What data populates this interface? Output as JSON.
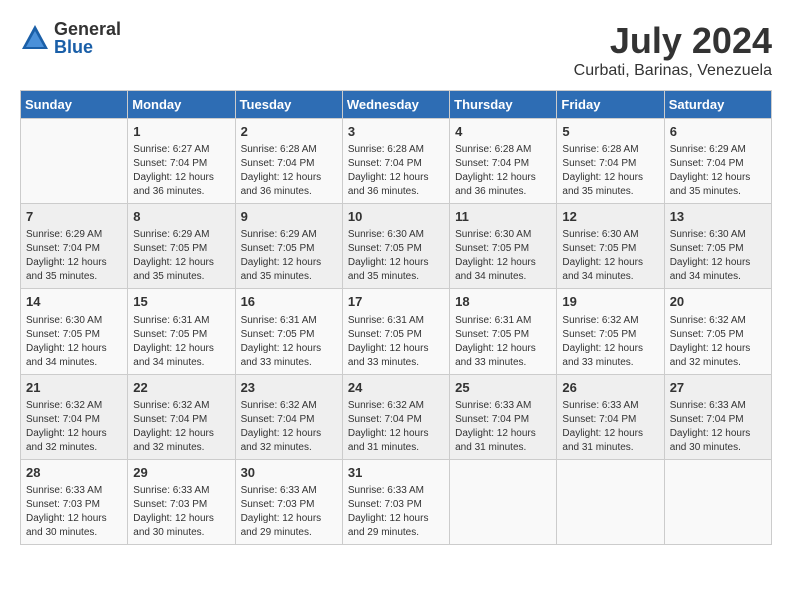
{
  "logo": {
    "general": "General",
    "blue": "Blue"
  },
  "title": {
    "month_year": "July 2024",
    "location": "Curbati, Barinas, Venezuela"
  },
  "days_of_week": [
    "Sunday",
    "Monday",
    "Tuesday",
    "Wednesday",
    "Thursday",
    "Friday",
    "Saturday"
  ],
  "weeks": [
    [
      {
        "day": "",
        "info": ""
      },
      {
        "day": "1",
        "info": "Sunrise: 6:27 AM\nSunset: 7:04 PM\nDaylight: 12 hours\nand 36 minutes."
      },
      {
        "day": "2",
        "info": "Sunrise: 6:28 AM\nSunset: 7:04 PM\nDaylight: 12 hours\nand 36 minutes."
      },
      {
        "day": "3",
        "info": "Sunrise: 6:28 AM\nSunset: 7:04 PM\nDaylight: 12 hours\nand 36 minutes."
      },
      {
        "day": "4",
        "info": "Sunrise: 6:28 AM\nSunset: 7:04 PM\nDaylight: 12 hours\nand 36 minutes."
      },
      {
        "day": "5",
        "info": "Sunrise: 6:28 AM\nSunset: 7:04 PM\nDaylight: 12 hours\nand 35 minutes."
      },
      {
        "day": "6",
        "info": "Sunrise: 6:29 AM\nSunset: 7:04 PM\nDaylight: 12 hours\nand 35 minutes."
      }
    ],
    [
      {
        "day": "7",
        "info": "Sunrise: 6:29 AM\nSunset: 7:04 PM\nDaylight: 12 hours\nand 35 minutes."
      },
      {
        "day": "8",
        "info": "Sunrise: 6:29 AM\nSunset: 7:05 PM\nDaylight: 12 hours\nand 35 minutes."
      },
      {
        "day": "9",
        "info": "Sunrise: 6:29 AM\nSunset: 7:05 PM\nDaylight: 12 hours\nand 35 minutes."
      },
      {
        "day": "10",
        "info": "Sunrise: 6:30 AM\nSunset: 7:05 PM\nDaylight: 12 hours\nand 35 minutes."
      },
      {
        "day": "11",
        "info": "Sunrise: 6:30 AM\nSunset: 7:05 PM\nDaylight: 12 hours\nand 34 minutes."
      },
      {
        "day": "12",
        "info": "Sunrise: 6:30 AM\nSunset: 7:05 PM\nDaylight: 12 hours\nand 34 minutes."
      },
      {
        "day": "13",
        "info": "Sunrise: 6:30 AM\nSunset: 7:05 PM\nDaylight: 12 hours\nand 34 minutes."
      }
    ],
    [
      {
        "day": "14",
        "info": "Sunrise: 6:30 AM\nSunset: 7:05 PM\nDaylight: 12 hours\nand 34 minutes."
      },
      {
        "day": "15",
        "info": "Sunrise: 6:31 AM\nSunset: 7:05 PM\nDaylight: 12 hours\nand 34 minutes."
      },
      {
        "day": "16",
        "info": "Sunrise: 6:31 AM\nSunset: 7:05 PM\nDaylight: 12 hours\nand 33 minutes."
      },
      {
        "day": "17",
        "info": "Sunrise: 6:31 AM\nSunset: 7:05 PM\nDaylight: 12 hours\nand 33 minutes."
      },
      {
        "day": "18",
        "info": "Sunrise: 6:31 AM\nSunset: 7:05 PM\nDaylight: 12 hours\nand 33 minutes."
      },
      {
        "day": "19",
        "info": "Sunrise: 6:32 AM\nSunset: 7:05 PM\nDaylight: 12 hours\nand 33 minutes."
      },
      {
        "day": "20",
        "info": "Sunrise: 6:32 AM\nSunset: 7:05 PM\nDaylight: 12 hours\nand 32 minutes."
      }
    ],
    [
      {
        "day": "21",
        "info": "Sunrise: 6:32 AM\nSunset: 7:04 PM\nDaylight: 12 hours\nand 32 minutes."
      },
      {
        "day": "22",
        "info": "Sunrise: 6:32 AM\nSunset: 7:04 PM\nDaylight: 12 hours\nand 32 minutes."
      },
      {
        "day": "23",
        "info": "Sunrise: 6:32 AM\nSunset: 7:04 PM\nDaylight: 12 hours\nand 32 minutes."
      },
      {
        "day": "24",
        "info": "Sunrise: 6:32 AM\nSunset: 7:04 PM\nDaylight: 12 hours\nand 31 minutes."
      },
      {
        "day": "25",
        "info": "Sunrise: 6:33 AM\nSunset: 7:04 PM\nDaylight: 12 hours\nand 31 minutes."
      },
      {
        "day": "26",
        "info": "Sunrise: 6:33 AM\nSunset: 7:04 PM\nDaylight: 12 hours\nand 31 minutes."
      },
      {
        "day": "27",
        "info": "Sunrise: 6:33 AM\nSunset: 7:04 PM\nDaylight: 12 hours\nand 30 minutes."
      }
    ],
    [
      {
        "day": "28",
        "info": "Sunrise: 6:33 AM\nSunset: 7:03 PM\nDaylight: 12 hours\nand 30 minutes."
      },
      {
        "day": "29",
        "info": "Sunrise: 6:33 AM\nSunset: 7:03 PM\nDaylight: 12 hours\nand 30 minutes."
      },
      {
        "day": "30",
        "info": "Sunrise: 6:33 AM\nSunset: 7:03 PM\nDaylight: 12 hours\nand 29 minutes."
      },
      {
        "day": "31",
        "info": "Sunrise: 6:33 AM\nSunset: 7:03 PM\nDaylight: 12 hours\nand 29 minutes."
      },
      {
        "day": "",
        "info": ""
      },
      {
        "day": "",
        "info": ""
      },
      {
        "day": "",
        "info": ""
      }
    ]
  ]
}
